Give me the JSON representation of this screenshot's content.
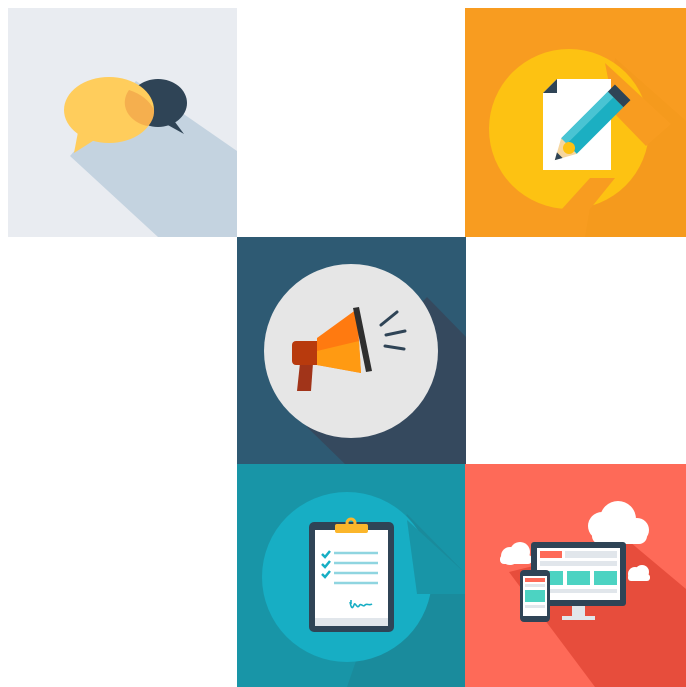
{
  "tiles": [
    {
      "id": "chat",
      "icon": "speech-bubbles-icon",
      "bg": "#E9ECF1",
      "shadow": "#C4D3E0"
    },
    {
      "id": "edit",
      "icon": "document-pencil-icon",
      "bg": "#F89C20",
      "circle": "#FDC212"
    },
    {
      "id": "announce",
      "icon": "megaphone-icon",
      "bg": "#2E5A73",
      "circle": "#E6E6E6"
    },
    {
      "id": "checklist",
      "icon": "clipboard-checklist-icon",
      "bg": "#1895A7",
      "circle": "#17AEC4"
    },
    {
      "id": "devices",
      "icon": "responsive-devices-cloud-icon",
      "bg": "#FE6A58",
      "shadow": "#E74D3C"
    }
  ]
}
